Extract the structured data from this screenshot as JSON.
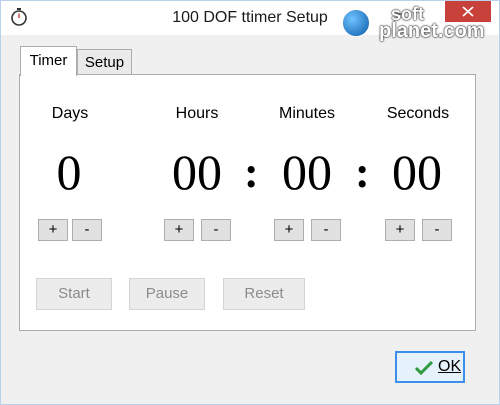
{
  "window": {
    "title": "100 DOF ttimer Setup"
  },
  "watermark": {
    "line1": "soft",
    "line2": "planet.com"
  },
  "tabs": [
    {
      "label": "Timer"
    },
    {
      "label": "Setup"
    }
  ],
  "timer": {
    "units": [
      {
        "label": "Days",
        "value": "0"
      },
      {
        "label": "Hours",
        "value": "00"
      },
      {
        "label": "Minutes",
        "value": "00"
      },
      {
        "label": "Seconds",
        "value": "00"
      }
    ],
    "separator": ":",
    "plus_label": "+",
    "minus_label": "-",
    "start_label": "Start",
    "pause_label": "Pause",
    "reset_label": "Reset"
  },
  "footer": {
    "ok_label": "OK"
  },
  "colors": {
    "close": "#c7413a",
    "accent": "#3c8ee8",
    "check": "#2f9a3f"
  },
  "icons": {
    "app": "stopwatch-icon",
    "ok": "checkmark-icon"
  }
}
